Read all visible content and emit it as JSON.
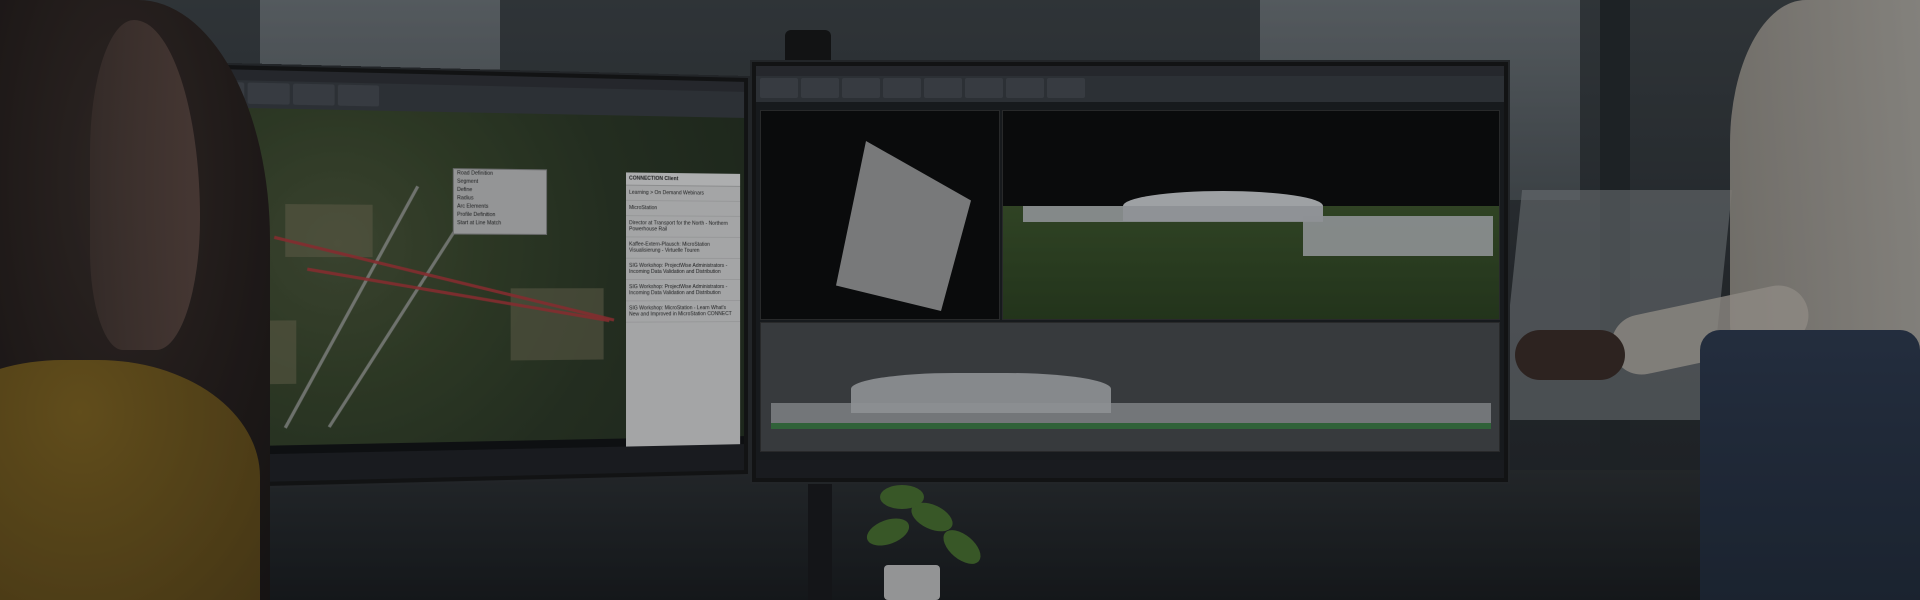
{
  "left_monitor": {
    "dialog": {
      "title": "Road Definition",
      "rows": [
        "Segment",
        "Define",
        "Radius"
      ],
      "checks": [
        "Arc Elements",
        "Profile Definition",
        "Start at Line Match"
      ]
    },
    "panel": {
      "header": "CONNECTION Client",
      "tab": "Learning > On Demand Webinars",
      "filter": "MicroStation",
      "items": [
        "Director at Transport for the North - Northern Powerhouse Rail",
        "Kaffee-Extern-Plausch: MicroStation Visualisierung - Virtuelle Touren",
        "SIG Workshop: ProjectWise Administrators - Incoming Data Validation and Distribution",
        "SIG Workshop: ProjectWise Administrators - Incoming Data Validation and Distribution",
        "SIG Workshop: MicroStation - Learn What's New and Improved in MicroStation CONNECT"
      ]
    }
  },
  "colors": {
    "ribbon": "#3a3e44",
    "aerial": "#3a4a2a",
    "road_highlight": "#c0393b",
    "sweater": "#8a6a1d"
  }
}
